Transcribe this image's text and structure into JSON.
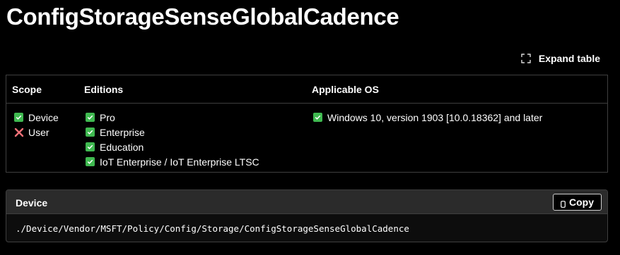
{
  "page": {
    "title": "ConfigStorageSenseGlobalCadence"
  },
  "toolbar": {
    "expand_label": "Expand table"
  },
  "table": {
    "headers": {
      "scope": "Scope",
      "editions": "Editions",
      "os": "Applicable OS"
    },
    "scope": [
      {
        "label": "Device",
        "status": "check"
      },
      {
        "label": "User",
        "status": "cross"
      }
    ],
    "editions": [
      {
        "label": "Pro",
        "status": "check"
      },
      {
        "label": "Enterprise",
        "status": "check"
      },
      {
        "label": "Education",
        "status": "check"
      },
      {
        "label": "IoT Enterprise / IoT Enterprise LTSC",
        "status": "check"
      }
    ],
    "os": [
      {
        "label": "Windows 10, version 1903 [10.0.18362] and later",
        "status": "check"
      }
    ]
  },
  "code_block": {
    "title": "Device",
    "copy_label": "Copy",
    "code": "./Device/Vendor/MSFT/Policy/Config/Storage/ConfigStorageSenseGlobalCadence"
  },
  "colors": {
    "background": "#000000",
    "check": "#3fb950",
    "cross": "#f07178",
    "border": "#3f3f3f"
  }
}
